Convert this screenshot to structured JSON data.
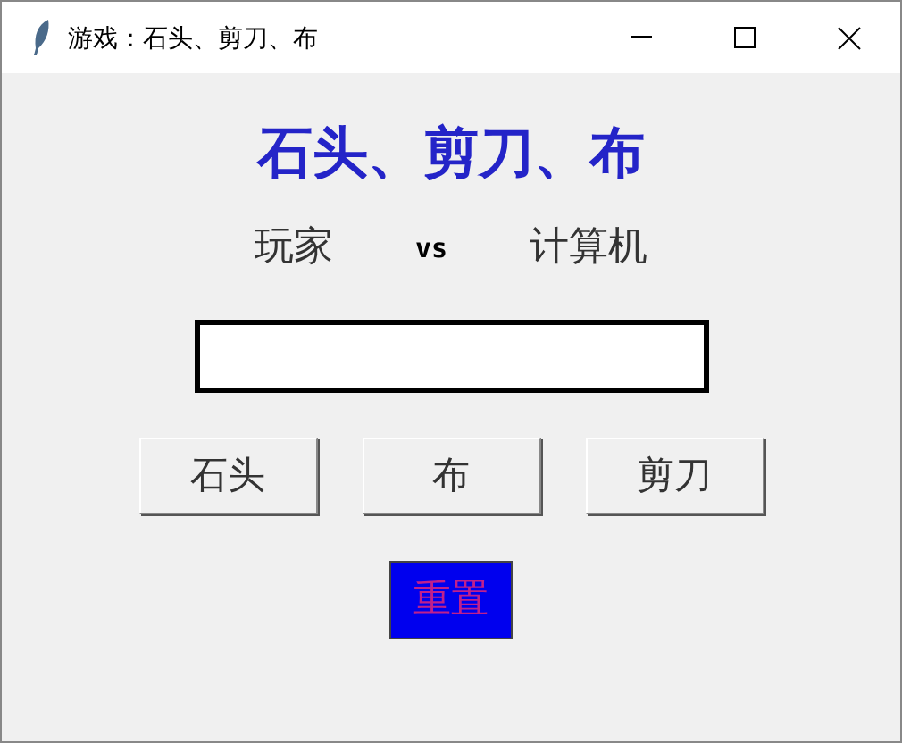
{
  "window": {
    "title": "游戏：石头、剪刀、布"
  },
  "heading": "石头、剪刀、布",
  "matchup": {
    "player": "玩家",
    "vs": "vs",
    "computer": "计算机"
  },
  "choice_buttons": [
    "石头",
    "布",
    "剪刀"
  ],
  "reset_button": "重置"
}
